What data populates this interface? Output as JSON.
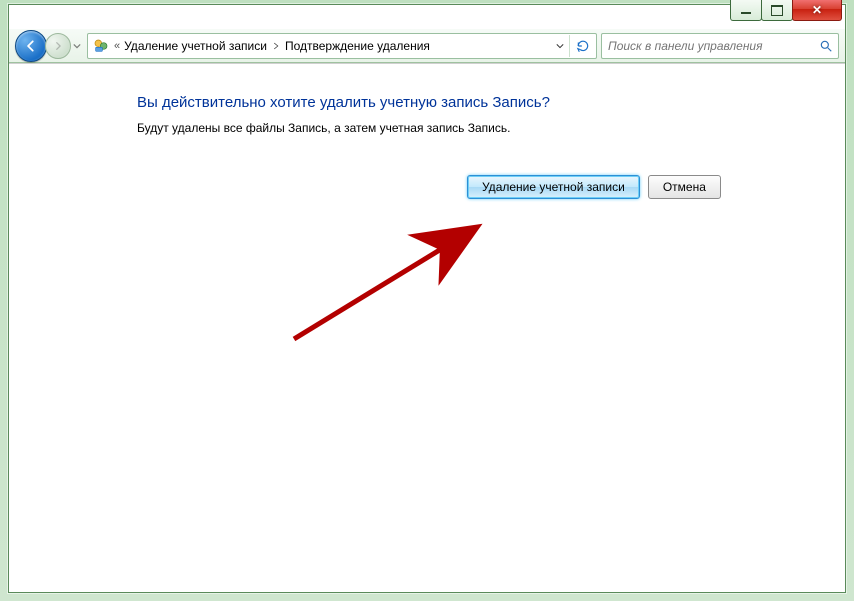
{
  "breadcrumb": {
    "item1": "Удаление учетной записи",
    "item2": "Подтверждение удаления"
  },
  "search": {
    "placeholder": "Поиск в панели управления"
  },
  "dialog": {
    "heading": "Вы действительно хотите удалить учетную запись Запись?",
    "body": "Будут удалены все файлы Запись, а затем учетная запись Запись."
  },
  "buttons": {
    "delete": "Удаление учетной записи",
    "cancel": "Отмена"
  }
}
